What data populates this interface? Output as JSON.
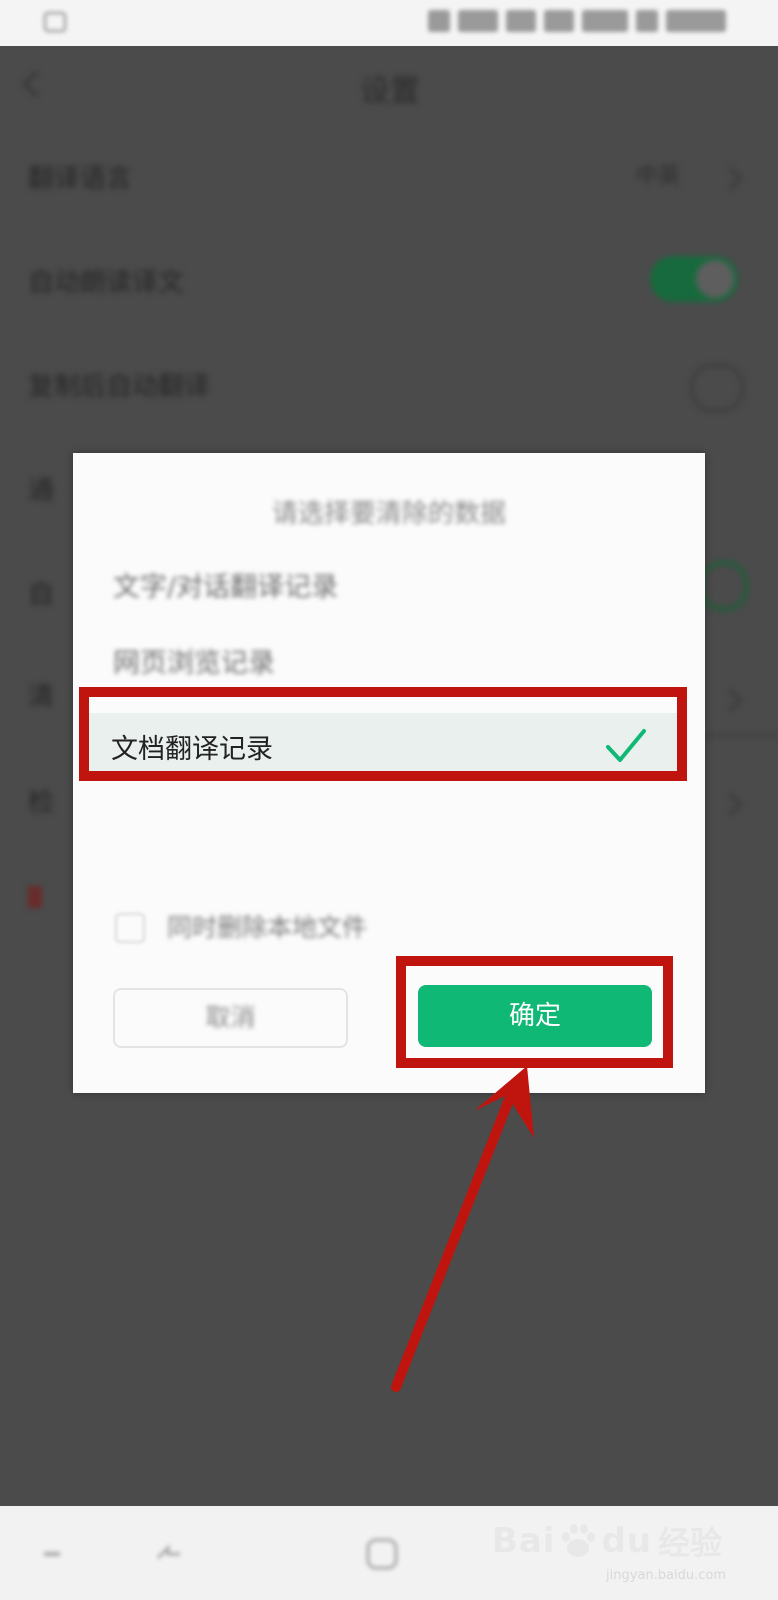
{
  "status_bar": {},
  "background": {
    "title": "设置",
    "rows": [
      {
        "label": "翻译语言",
        "value": "中英"
      },
      {
        "label": "自动朗读译文"
      },
      {
        "label": "复制后自动翻译"
      },
      {
        "label": "通"
      },
      {
        "label": "自"
      },
      {
        "label": "清"
      },
      {
        "label": "检"
      }
    ]
  },
  "dialog": {
    "title": "请选择要清除的数据",
    "options": [
      {
        "label": "文字/对话翻译记录",
        "checked": false
      },
      {
        "label": "网页浏览记录",
        "checked": false
      },
      {
        "label": "文档翻译记录",
        "checked": true
      }
    ],
    "delete_local_files": {
      "label": "同时删除本地文件",
      "checked": false
    },
    "cancel_label": "取消",
    "confirm_label": "确定"
  },
  "annotation": {
    "color": "#c0150f"
  },
  "watermark": {
    "brand": "Bai",
    "brand2": "du",
    "suffix": "经验",
    "url": "jingyan.baidu.com"
  },
  "colors": {
    "accent": "#0fb874",
    "selected_bg": "#e9f0ee",
    "annotation": "#c0150f"
  }
}
